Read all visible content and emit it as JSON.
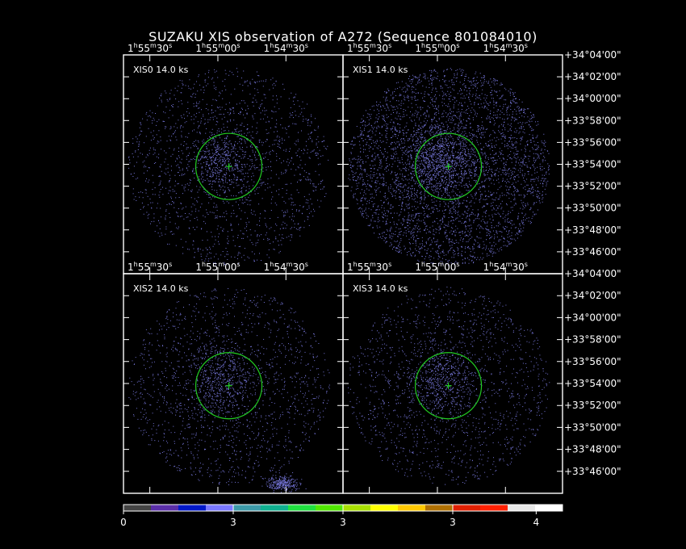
{
  "title": "SUZAKU XIS observation of A272  (Sequence 801084010)",
  "panels": [
    {
      "label": "XIS0 14.0 ks",
      "dense": false,
      "blob": false
    },
    {
      "label": "XIS1 14.0 ks",
      "dense": true,
      "blob": false
    },
    {
      "label": "XIS2 14.0 ks",
      "dense": false,
      "blob": true
    },
    {
      "label": "XIS3 14.0 ks",
      "dense": false,
      "blob": false
    }
  ],
  "ra_ticks": [
    {
      "h": "1",
      "m": "55",
      "s": "30"
    },
    {
      "h": "1",
      "m": "55",
      "s": "00"
    },
    {
      "h": "1",
      "m": "54",
      "s": "30"
    }
  ],
  "dec_ticks_top": [
    "+34°04'00\"",
    "+34°02'00\"",
    "+34°00'00\"",
    "+33°58'00\"",
    "+33°56'00\"",
    "+33°54'00\"",
    "+33°52'00\"",
    "+33°50'00\"",
    "+33°48'00\"",
    "+33°46'00\""
  ],
  "dec_ticks_bottom": [
    "+34°04'00\"",
    "+34°02'00\"",
    "+34°00'00\"",
    "+33°58'00\"",
    "+33°56'00\"",
    "+33°54'00\"",
    "+33°52'00\"",
    "+33°50'00\"",
    "+33°48'00\"",
    "+33°46'00\""
  ],
  "colorbar": {
    "colors": [
      "#444444",
      "#5a2ea8",
      "#0018c8",
      "#7a78ff",
      "#3c9aa8",
      "#10b090",
      "#20e040",
      "#50e800",
      "#a8e000",
      "#ffff00",
      "#ffc800",
      "#b07000",
      "#e02000",
      "#ff2000",
      "#e8e8e8",
      "#ffffff"
    ],
    "tick_labels": [
      "0",
      "3",
      "3",
      "3",
      "4"
    ]
  },
  "colors": {
    "region": "#22cc22",
    "events": "#8a8aff",
    "frame": "#ffffff"
  }
}
